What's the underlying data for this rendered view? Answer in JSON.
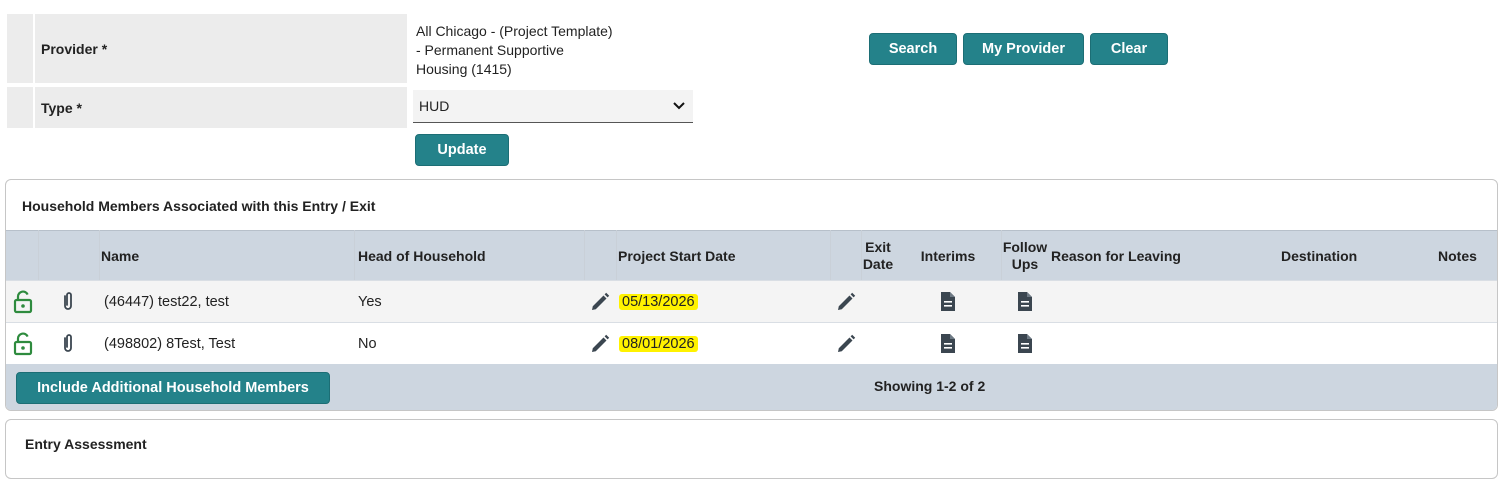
{
  "form": {
    "provider_label": "Provider *",
    "provider_value_line1": "All Chicago - (Project Template)",
    "provider_value_line2": "- Permanent Supportive",
    "provider_value_line3": "Housing (1415)",
    "type_label": "Type *",
    "type_value": "HUD",
    "update_label": "Update"
  },
  "actions": {
    "search_label": "Search",
    "my_provider_label": "My Provider",
    "clear_label": "Clear"
  },
  "household": {
    "title": "Household Members Associated with this Entry / Exit",
    "columns": {
      "name": "Name",
      "head_of_household": "Head of Household",
      "project_start_date": "Project Start Date",
      "exit_date_line1": "Exit",
      "exit_date_line2": "Date",
      "interims": "Interims",
      "follow_ups_line1": "Follow",
      "follow_ups_line2": "Ups",
      "reason_for_leaving": "Reason for Leaving",
      "destination": "Destination",
      "notes": "Notes"
    },
    "rows": [
      {
        "name": "(46447) test22, test",
        "head_of_household": "Yes",
        "project_start_date": "05/13/2026"
      },
      {
        "name": "(498802) 8Test, Test",
        "head_of_household": "No",
        "project_start_date": "08/01/2026"
      }
    ],
    "include_button_label": "Include Additional Household Members",
    "showing_text": "Showing 1-2 of 2"
  },
  "entry_assessment": {
    "title": "Entry Assessment"
  },
  "colors": {
    "accent": "#24828a",
    "header_bg": "#cdd6e0",
    "highlight": "#fff200",
    "unlock_icon": "#2e8b3e",
    "icon_dark": "#3b4650"
  }
}
